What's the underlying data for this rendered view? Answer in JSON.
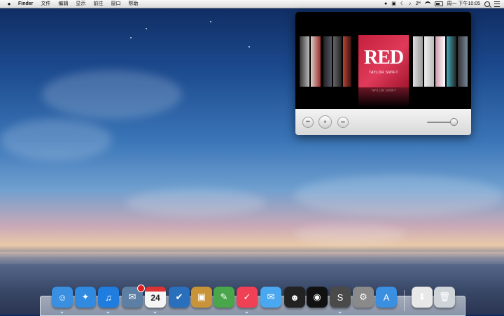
{
  "menubar": {
    "app_name": "Finder",
    "menus": [
      "文件",
      "编辑",
      "显示",
      "前往",
      "窗口",
      "帮助"
    ],
    "clock": "周一 下午10:05",
    "volume_glyph": "♪",
    "bluetooth_glyph": "2ᴴ"
  },
  "player": {
    "album_title": "RED",
    "artist": "TAYLOR SWIFT",
    "reflection_text": "TAYLOR SWIFT",
    "prev_icon": "⏮",
    "pause_icon": "⏸",
    "next_icon": "⏭",
    "volume_level": 0.85
  },
  "dock": {
    "calendar_day": "24",
    "items": [
      {
        "name": "finder",
        "color": "#3a8fe0",
        "glyph": "☺"
      },
      {
        "name": "safari",
        "color": "#2f8ae0",
        "glyph": "✦"
      },
      {
        "name": "itunes",
        "color": "#1f7de0",
        "glyph": "♫"
      },
      {
        "name": "mail",
        "color": "#5c7fa3",
        "glyph": "✉"
      },
      {
        "name": "calendar",
        "color": "#f5f5f5",
        "glyph": ""
      },
      {
        "name": "reminders",
        "color": "#2a6fbb",
        "glyph": "✔"
      },
      {
        "name": "stuffit",
        "color": "#c9933a",
        "glyph": "▣"
      },
      {
        "name": "evernote",
        "color": "#4aa64a",
        "glyph": "✎"
      },
      {
        "name": "pocket",
        "color": "#ef4056",
        "glyph": "✓"
      },
      {
        "name": "messages",
        "color": "#4aa8f0",
        "glyph": "✉"
      },
      {
        "name": "qq",
        "color": "#222",
        "glyph": "☻"
      },
      {
        "name": "camera",
        "color": "#111",
        "glyph": "◉"
      },
      {
        "name": "sublime",
        "color": "#4a4a4a",
        "glyph": "S"
      },
      {
        "name": "system-preferences",
        "color": "#8a8a8a",
        "glyph": "⚙"
      },
      {
        "name": "app-store",
        "color": "#3a8fe0",
        "glyph": "A"
      },
      {
        "name": "downloads",
        "color": "#e8e8e8",
        "glyph": "⬇"
      },
      {
        "name": "trash",
        "color": "#cfd4d9",
        "glyph": "🗑"
      }
    ]
  }
}
